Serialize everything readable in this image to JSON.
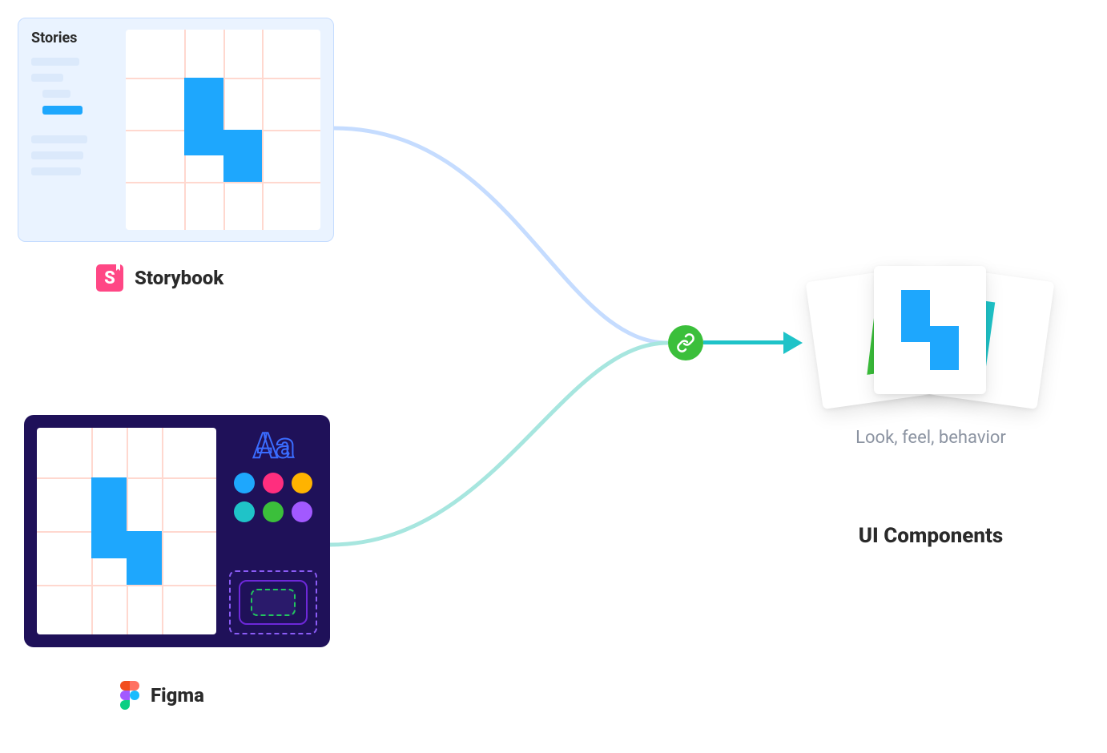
{
  "storybook": {
    "sidebar_title": "Stories",
    "label": "Storybook",
    "logo_letter": "S"
  },
  "figma": {
    "label": "Figma",
    "typography_sample": "Aa",
    "swatches": [
      "#1ea7fd",
      "#ff2e7e",
      "#ffb300",
      "#1fc3c8",
      "#3bbf3b",
      "#a259ff"
    ]
  },
  "output": {
    "caption": "Look, feel, behavior",
    "heading": "UI Components"
  },
  "link_icon": "link-icon",
  "colors": {
    "blue": "#1ea7fd",
    "teal": "#1fc3c8",
    "green": "#3bbf3b",
    "pink": "#ff4785",
    "indigo": "#1f1159"
  }
}
